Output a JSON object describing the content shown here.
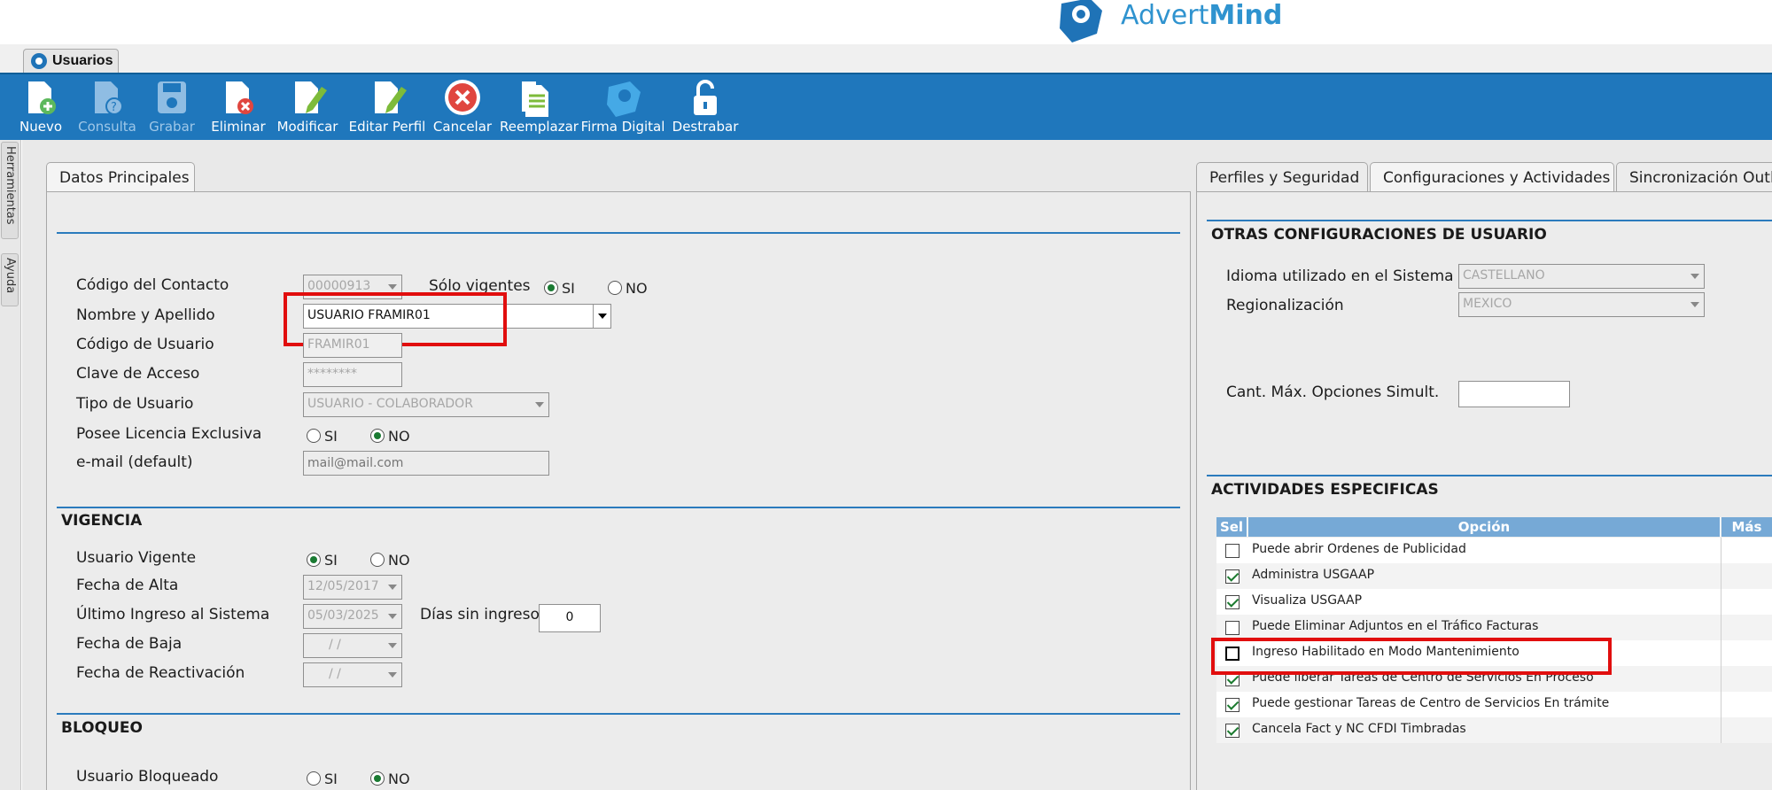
{
  "brand": {
    "name_light": "Advert",
    "name_bold": "Mind"
  },
  "document_tab": {
    "label": "Usuarios"
  },
  "toolbar": {
    "buttons": [
      {
        "label": "Nuevo",
        "icon": "new-doc-icon",
        "enabled": true
      },
      {
        "label": "Consulta",
        "icon": "query-doc-icon",
        "enabled": false
      },
      {
        "label": "Grabar",
        "icon": "save-icon",
        "enabled": false
      },
      {
        "label": "Eliminar",
        "icon": "delete-doc-icon",
        "enabled": true
      },
      {
        "label": "Modificar",
        "icon": "edit-doc-icon",
        "enabled": true
      },
      {
        "label": "Editar Perfil",
        "icon": "edit-profile-icon",
        "enabled": true
      },
      {
        "label": "Cancelar",
        "icon": "cancel-icon",
        "enabled": true
      },
      {
        "label": "Reemplazar",
        "icon": "replace-icon",
        "enabled": true
      },
      {
        "label": "Firma Digital",
        "icon": "digital-signature-icon",
        "enabled": true
      },
      {
        "label": "Destrabar",
        "icon": "unlock-icon",
        "enabled": true
      }
    ]
  },
  "side_rail": {
    "tabs": [
      "Herramientas",
      "Ayuda"
    ]
  },
  "left_panel": {
    "tab": "Datos Principales",
    "fields": {
      "codigo_contacto": {
        "label": "Código del Contacto",
        "value": "00000913"
      },
      "solo_vigentes": {
        "label": "Sólo vigentes",
        "options": [
          "SI",
          "NO"
        ],
        "selected": "SI"
      },
      "nombre_apellido": {
        "label": "Nombre y Apellido",
        "value": "USUARIO FRAMIR01"
      },
      "codigo_usuario": {
        "label": "Código de Usuario",
        "value": "FRAMIR01"
      },
      "clave_acceso": {
        "label": "Clave de Acceso",
        "value": "********"
      },
      "tipo_usuario": {
        "label": "Tipo de Usuario",
        "value": "USUARIO - COLABORADOR"
      },
      "licencia_exclusiva": {
        "label": "Posee Licencia Exclusiva",
        "options": [
          "SI",
          "NO"
        ],
        "selected": "NO"
      },
      "email": {
        "label": "e-mail (default)",
        "placeholder": "mail@mail.com"
      }
    },
    "vigencia": {
      "title": "VIGENCIA",
      "usuario_vigente": {
        "label": "Usuario Vigente",
        "options": [
          "SI",
          "NO"
        ],
        "selected": "SI"
      },
      "fecha_alta": {
        "label": "Fecha de Alta",
        "value": "12/05/2017"
      },
      "ultimo_ingreso": {
        "label": "Último Ingreso al Sistema",
        "value": "05/03/2025"
      },
      "dias_sin_ingreso": {
        "label": "Días sin ingreso",
        "value": "0"
      },
      "fecha_baja": {
        "label": "Fecha de Baja",
        "value": "/ /"
      },
      "fecha_reactivacion": {
        "label": "Fecha de Reactivación",
        "value": "/ /"
      }
    },
    "bloqueo": {
      "title": "BLOQUEO",
      "usuario_bloqueado": {
        "label": "Usuario Bloqueado",
        "options": [
          "SI",
          "NO"
        ],
        "selected": "NO"
      }
    }
  },
  "right_panel": {
    "tabs": [
      "Perfiles y Seguridad",
      "Configuraciones y Actividades",
      "Sincronización Outlo"
    ],
    "active_tab": "Configuraciones y Actividades",
    "otras_config": {
      "title": "OTRAS CONFIGURACIONES DE USUARIO",
      "idioma": {
        "label": "Idioma utilizado en el Sistema",
        "value": "CASTELLANO"
      },
      "regionalizacion": {
        "label": "Regionalización",
        "value": "MEXICO"
      },
      "cant_max": {
        "label": "Cant. Máx. Opciones Simult.",
        "value": ""
      }
    },
    "actividades": {
      "title": "ACTIVIDADES ESPECIFICAS",
      "columns": [
        "Sel",
        "Opción",
        "Más"
      ],
      "rows": [
        {
          "option": "Puede abrir Ordenes de Publicidad",
          "selected": false
        },
        {
          "option": "Administra USGAAP",
          "selected": true
        },
        {
          "option": "Visualiza USGAAP",
          "selected": true
        },
        {
          "option": "Puede Eliminar Adjuntos en el Tráfico Facturas",
          "selected": false
        },
        {
          "option": "Ingreso Habilitado en Modo Mantenimiento",
          "selected": false
        },
        {
          "option": "Puede liberar Tareas de Centro de Servicios En Proceso",
          "selected": true
        },
        {
          "option": "Puede gestionar Tareas de Centro de Servicios En trámite",
          "selected": true
        },
        {
          "option": "Cancela Fact y NC CFDI Timbradas",
          "selected": true
        }
      ]
    }
  },
  "colors": {
    "toolbar_bg": "#1f77bc",
    "accent": "#2b7bbd",
    "highlight_box": "#e10e0e",
    "grid_header": "#76a9d6"
  }
}
